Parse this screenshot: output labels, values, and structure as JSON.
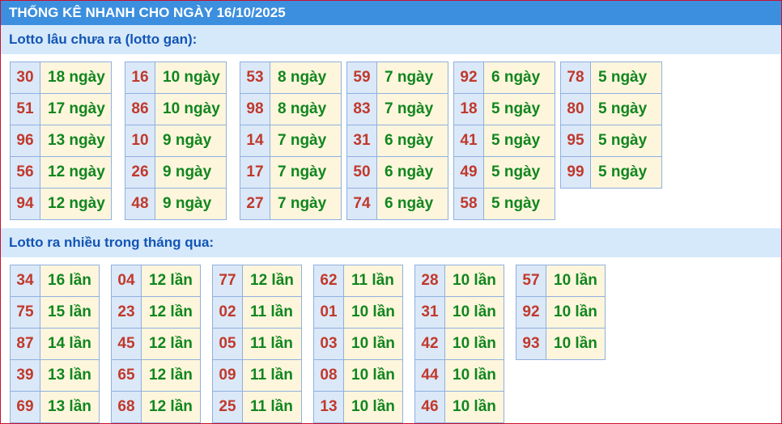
{
  "title": "THỐNG KÊ NHANH CHO NGÀY 16/10/2025",
  "gan": {
    "heading": "Lotto lâu chưa ra (lotto gan):",
    "columns": [
      [
        {
          "n": "30",
          "v": "18 ngày"
        },
        {
          "n": "51",
          "v": "17 ngày"
        },
        {
          "n": "96",
          "v": "13 ngày"
        },
        {
          "n": "56",
          "v": "12 ngày"
        },
        {
          "n": "94",
          "v": "12 ngày"
        }
      ],
      [
        {
          "n": "16",
          "v": "10 ngày"
        },
        {
          "n": "86",
          "v": "10 ngày"
        },
        {
          "n": "10",
          "v": "9 ngày"
        },
        {
          "n": "26",
          "v": "9 ngày"
        },
        {
          "n": "48",
          "v": "9 ngày"
        }
      ],
      [
        {
          "n": "53",
          "v": "8 ngày"
        },
        {
          "n": "98",
          "v": "8 ngày"
        },
        {
          "n": "14",
          "v": "7 ngày"
        },
        {
          "n": "17",
          "v": "7 ngày"
        },
        {
          "n": "27",
          "v": "7 ngày"
        }
      ],
      [
        {
          "n": "59",
          "v": "7 ngày"
        },
        {
          "n": "83",
          "v": "7 ngày"
        },
        {
          "n": "31",
          "v": "6 ngày"
        },
        {
          "n": "50",
          "v": "6 ngày"
        },
        {
          "n": "74",
          "v": "6 ngày"
        }
      ],
      [
        {
          "n": "92",
          "v": "6 ngày"
        },
        {
          "n": "18",
          "v": "5 ngày"
        },
        {
          "n": "41",
          "v": "5 ngày"
        },
        {
          "n": "49",
          "v": "5 ngày"
        },
        {
          "n": "58",
          "v": "5 ngày"
        }
      ],
      [
        {
          "n": "78",
          "v": "5 ngày"
        },
        {
          "n": "80",
          "v": "5 ngày"
        },
        {
          "n": "95",
          "v": "5 ngày"
        },
        {
          "n": "99",
          "v": "5 ngày"
        }
      ]
    ]
  },
  "nhieu": {
    "heading": "Lotto ra nhiều trong tháng qua:",
    "columns": [
      [
        {
          "n": "34",
          "v": "16 lần"
        },
        {
          "n": "75",
          "v": "15 lần"
        },
        {
          "n": "87",
          "v": "14 lần"
        },
        {
          "n": "39",
          "v": "13 lần"
        },
        {
          "n": "69",
          "v": "13 lần"
        }
      ],
      [
        {
          "n": "04",
          "v": "12 lần"
        },
        {
          "n": "23",
          "v": "12 lần"
        },
        {
          "n": "45",
          "v": "12 lần"
        },
        {
          "n": "65",
          "v": "12 lần"
        },
        {
          "n": "68",
          "v": "12 lần"
        }
      ],
      [
        {
          "n": "77",
          "v": "12 lần"
        },
        {
          "n": "02",
          "v": "11 lần"
        },
        {
          "n": "05",
          "v": "11 lần"
        },
        {
          "n": "09",
          "v": "11 lần"
        },
        {
          "n": "25",
          "v": "11 lần"
        }
      ],
      [
        {
          "n": "62",
          "v": "11 lần"
        },
        {
          "n": "01",
          "v": "10 lần"
        },
        {
          "n": "03",
          "v": "10 lần"
        },
        {
          "n": "08",
          "v": "10 lần"
        },
        {
          "n": "13",
          "v": "10 lần"
        }
      ],
      [
        {
          "n": "28",
          "v": "10 lần"
        },
        {
          "n": "31",
          "v": "10 lần"
        },
        {
          "n": "42",
          "v": "10 lần"
        },
        {
          "n": "44",
          "v": "10 lần"
        },
        {
          "n": "46",
          "v": "10 lần"
        }
      ],
      [
        {
          "n": "57",
          "v": "10 lần"
        },
        {
          "n": "92",
          "v": "10 lần"
        },
        {
          "n": "93",
          "v": "10 lần"
        }
      ]
    ]
  }
}
